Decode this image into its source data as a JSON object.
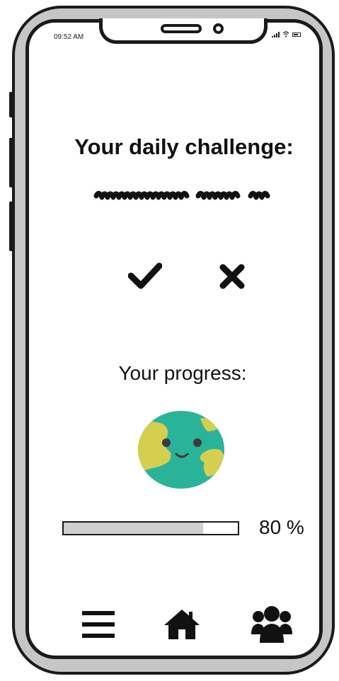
{
  "status_bar": {
    "time": "09:52 AM"
  },
  "challenge": {
    "heading": "Your daily challenge:"
  },
  "actions": {
    "accept_icon": "check-icon",
    "reject_icon": "close-icon"
  },
  "progress": {
    "label": "Your progress:",
    "percent_text": "80 %",
    "value": 0.8,
    "avatar_icon": "earth-icon"
  },
  "bottom_nav": {
    "items": [
      {
        "icon": "menu-icon"
      },
      {
        "icon": "home-icon"
      },
      {
        "icon": "users-icon"
      }
    ]
  },
  "colors": {
    "earth_ocean": "#2bb39a",
    "earth_land": "#d4cf4f",
    "progress_fill": "#cfcfcf",
    "ink": "#1a1a1a"
  }
}
